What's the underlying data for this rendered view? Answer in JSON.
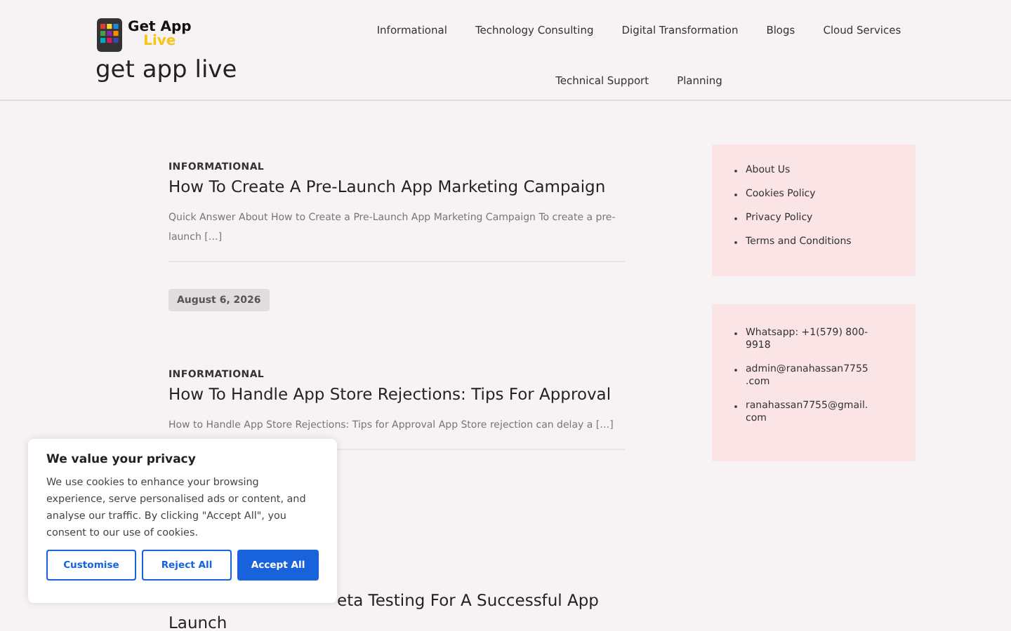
{
  "site": {
    "logo_line1": "Get App",
    "logo_line2": "Live",
    "title": "get app live"
  },
  "nav": [
    "Informational",
    "Technology Consulting",
    "Digital Transformation",
    "Blogs",
    "Cloud Services",
    "Technical Support",
    "Planning"
  ],
  "posts": [
    {
      "category": "INFORMATIONAL",
      "title": "How To Create A Pre-Launch App Marketing Campaign",
      "excerpt": "Quick Answer About How to Create a Pre-Launch App Marketing Campaign To create a pre-launch […]",
      "date": "August 6, 2026"
    },
    {
      "category": "INFORMATIONAL",
      "title": "How To Handle App Store Rejections: Tips For Approval",
      "excerpt": "How to Handle App Store Rejections: Tips for Approval App Store rejection can delay a […]"
    },
    {
      "title": "eta Testing For A Successful App Launch"
    }
  ],
  "sidebar": [
    {
      "items": [
        "About Us",
        "Cookies Policy",
        "Privacy Policy",
        "Terms and Conditions"
      ]
    },
    {
      "items": [
        "Whatsapp: +1(579) 800-9918",
        "admin@ranahassan7755 .com",
        "ranahassan7755@gmail. com"
      ]
    }
  ],
  "cookie_banner": {
    "title": "We value your privacy",
    "text": "We use cookies to enhance your browsing experience, serve personalised ads or content, and analyse our traffic. By clicking \"Accept All\", you consent to our use of cookies.",
    "buttons": [
      {
        "label": "Customise",
        "kind": "outline"
      },
      {
        "label": "Reject All",
        "kind": "outline"
      },
      {
        "label": "Accept All",
        "kind": "primary"
      }
    ]
  }
}
